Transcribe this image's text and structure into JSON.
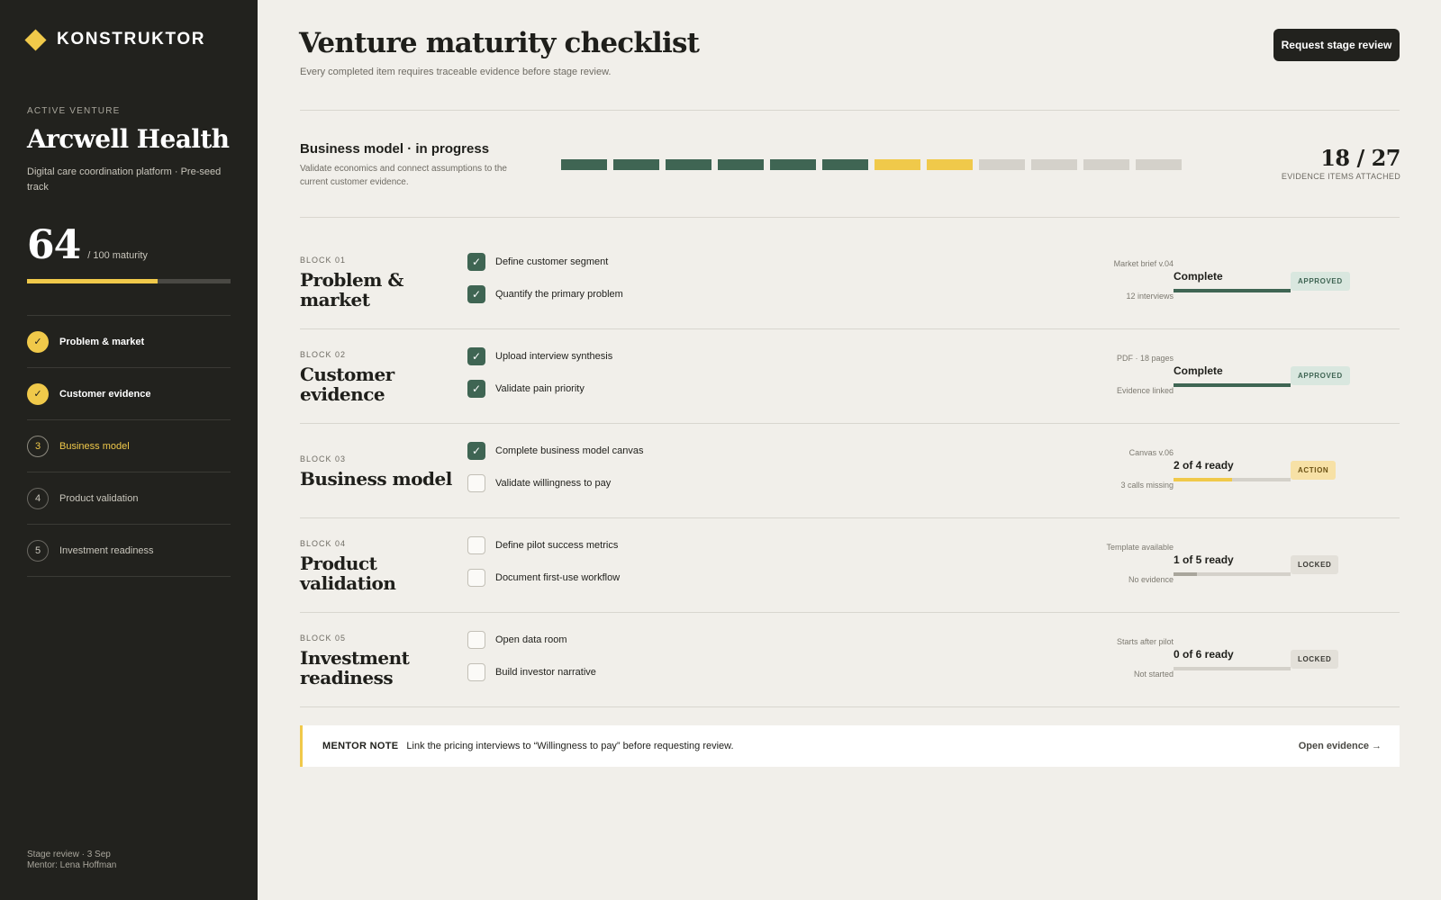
{
  "brand": {
    "name": "KONSTRUKTOR"
  },
  "venture": {
    "label": "ACTIVE VENTURE",
    "name": "Arcwell Health",
    "description": "Digital care coordination platform · Pre-seed track",
    "score": "64",
    "score_suffix": "/ 100 maturity",
    "score_value": 64
  },
  "stages": [
    {
      "marker": "✓",
      "label": "Problem & market",
      "state": "done"
    },
    {
      "marker": "✓",
      "label": "Customer evidence",
      "state": "done"
    },
    {
      "marker": "3",
      "label": "Business model",
      "state": "current"
    },
    {
      "marker": "4",
      "label": "Product validation",
      "state": "todo"
    },
    {
      "marker": "5",
      "label": "Investment readiness",
      "state": "todo"
    }
  ],
  "sidebar_footer": {
    "review": "Stage review · 3 Sep",
    "mentor": "Mentor: Lena Hoffman"
  },
  "header": {
    "title": "Venture maturity checklist",
    "subtitle": "Every completed item requires traceable evidence before stage review.",
    "review_button": "Request stage review"
  },
  "phase": {
    "title": "Business model · in progress",
    "description": "Validate economics and connect assumptions to the current customer evidence.",
    "segments": [
      "done",
      "done",
      "done",
      "done",
      "done",
      "done",
      "progress",
      "progress",
      "todo",
      "todo",
      "todo",
      "todo"
    ],
    "evidence_count": "18 / 27",
    "evidence_label": "EVIDENCE ITEMS ATTACHED"
  },
  "blocks": [
    {
      "label": "BLOCK 01",
      "name": "Problem & market",
      "items": [
        {
          "checked": true,
          "check_mark": "✓",
          "label": "Define customer segment"
        },
        {
          "checked": true,
          "check_mark": "✓",
          "label": "Quantify the primary problem"
        }
      ],
      "meta_top": "Market brief v.04",
      "meta_bottom": "12 interviews",
      "status": "Complete",
      "progress": 1.0,
      "bar_color": "#3f6553",
      "badge": "APPROVED",
      "badge_type": "approved"
    },
    {
      "label": "BLOCK 02",
      "name": "Customer evidence",
      "items": [
        {
          "checked": true,
          "check_mark": "✓",
          "label": "Upload interview synthesis"
        },
        {
          "checked": true,
          "check_mark": "✓",
          "label": "Validate pain priority"
        }
      ],
      "meta_top": "PDF · 18 pages",
      "meta_bottom": "Evidence linked",
      "status": "Complete",
      "progress": 1.0,
      "bar_color": "#3f6553",
      "badge": "APPROVED",
      "badge_type": "approved"
    },
    {
      "label": "BLOCK 03",
      "name": "Business model",
      "items": [
        {
          "checked": true,
          "check_mark": "✓",
          "label": "Complete business model canvas"
        },
        {
          "checked": false,
          "check_mark": "",
          "label": "Validate willingness to pay"
        }
      ],
      "meta_top": "Canvas v.06",
      "meta_bottom": "3 calls missing",
      "status": "2 of 4 ready",
      "progress": 0.5,
      "bar_color": "#f0c94a",
      "badge": "ACTION",
      "badge_type": "action"
    },
    {
      "label": "BLOCK 04",
      "name": "Product validation",
      "items": [
        {
          "checked": false,
          "check_mark": "",
          "label": "Define pilot success metrics"
        },
        {
          "checked": false,
          "check_mark": "",
          "label": "Document first-use workflow"
        }
      ],
      "meta_top": "Template available",
      "meta_bottom": "No evidence",
      "status": "1 of 5 ready",
      "progress": 0.2,
      "bar_color": "#a9a69c",
      "badge": "LOCKED",
      "badge_type": "locked"
    },
    {
      "label": "BLOCK 05",
      "name": "Investment readiness",
      "items": [
        {
          "checked": false,
          "check_mark": "",
          "label": "Open data room"
        },
        {
          "checked": false,
          "check_mark": "",
          "label": "Build investor narrative"
        }
      ],
      "meta_top": "Starts after pilot",
      "meta_bottom": "Not started",
      "status": "0 of 6 ready",
      "progress": 0.0,
      "bar_color": "#a9a69c",
      "badge": "LOCKED",
      "badge_type": "locked"
    }
  ],
  "mentor_note": {
    "tag": "MENTOR NOTE",
    "text": "Link the pricing interviews to “Willingness to pay” before requesting review.",
    "link": "Open evidence →"
  }
}
